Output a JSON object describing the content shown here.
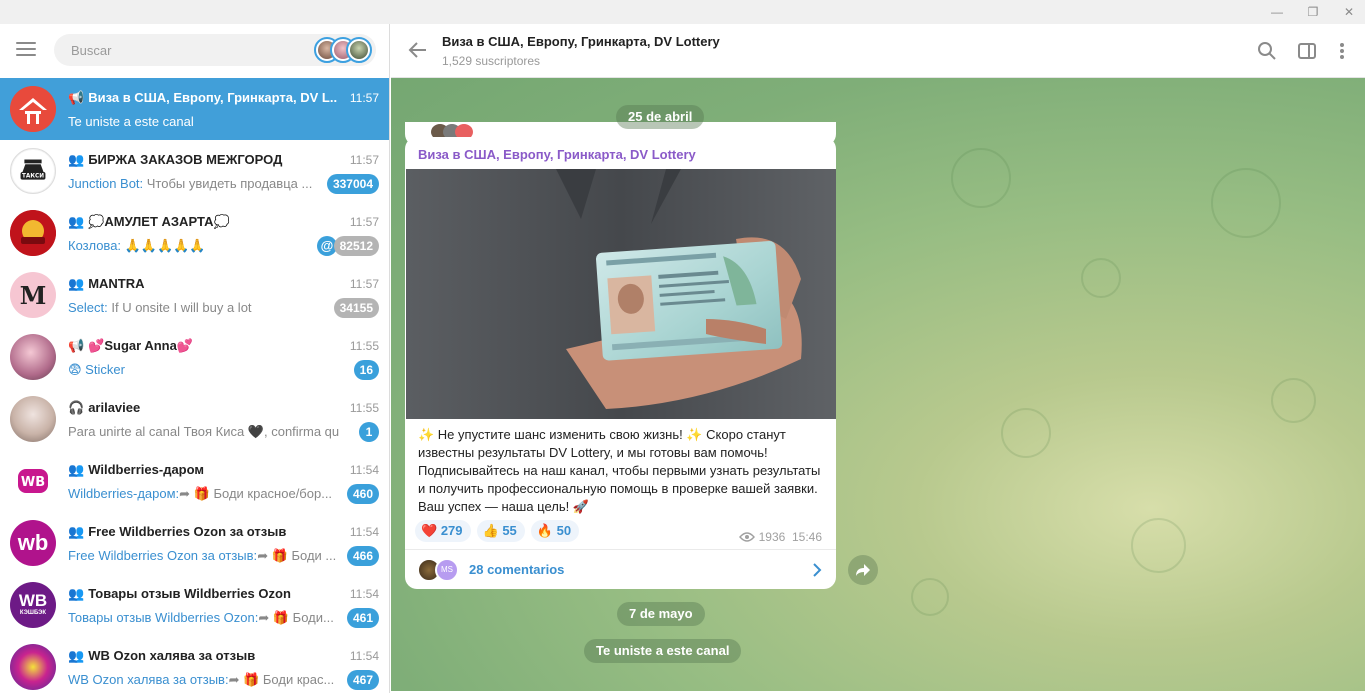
{
  "window": {
    "minimize": "—",
    "restore": "❐",
    "close": "✕"
  },
  "search": {
    "placeholder": "Buscar"
  },
  "chats": [
    {
      "title": "Виза в США, Европу, Гринкарта, DV L...",
      "type_icon": "📢",
      "time": "11:57",
      "sender": "",
      "preview": "Te uniste a este canal",
      "badge": "",
      "active": true
    },
    {
      "title": "БИРЖА ЗАКАЗОВ МЕЖГОРОД",
      "type_icon": "👥",
      "time": "11:57",
      "sender": "Junction Bot:",
      "preview": " Чтобы увидеть продавца ...",
      "badge": "337004"
    },
    {
      "title": "💭АМУЛЕТ АЗАРТА💭",
      "type_icon": "👥",
      "time": "11:57",
      "sender": "Козлова:",
      "preview": " 🙏🙏🙏🙏🙏",
      "badge": "82512",
      "mention": "@"
    },
    {
      "title": "MANTRA",
      "type_icon": "👥",
      "time": "11:57",
      "sender": "Select:",
      "preview": " If U onsite I will buy a lot",
      "badge": "34155"
    },
    {
      "title": "💕Sugar Anna💕",
      "type_icon": "📢",
      "time": "11:55",
      "sender": "😨 Sticker",
      "preview": "",
      "badge": "16"
    },
    {
      "title": "arilaviee",
      "type_icon": "🎧",
      "time": "11:55",
      "sender": "",
      "preview": "Para unirte al canal Твоя Киса 🖤, confirma qu...",
      "badge": "1"
    },
    {
      "title": "Wildberries-даром",
      "type_icon": "👥",
      "time": "11:54",
      "sender": "Wildberries-даром:",
      "preview": "➦ 🎁 Боди красное/бор...",
      "badge": "460"
    },
    {
      "title": "Free Wildberries Ozon за отзыв",
      "type_icon": "👥",
      "time": "11:54",
      "sender": "Free Wildberries Ozon за отзыв:",
      "preview": "➦ 🎁 Боди ...",
      "badge": "466"
    },
    {
      "title": "Товары отзыв Wildberries Ozon",
      "type_icon": "👥",
      "time": "11:54",
      "sender": "Товары отзыв Wildberries Ozon:",
      "preview": "➦ 🎁 Боди...",
      "badge": "461"
    },
    {
      "title": "WB Ozon халява за отзыв",
      "type_icon": "👥",
      "time": "11:54",
      "sender": "WB Ozon халява за отзыв:",
      "preview": "➦ 🎁 Боди крас...",
      "badge": "467"
    }
  ],
  "avatars": {
    "taxi": "ТАКСИ",
    "mantra": "M",
    "wb1": "WB",
    "wb2": "wb",
    "wb3": "WB",
    "wb3_sub": "КЭШБЭК"
  },
  "channel": {
    "title": "Виза в США, Европу, Гринкарта, DV Lottery",
    "subtitle": "1,529 suscriptores"
  },
  "messages": {
    "date1": "25 de abril",
    "post_author": "Виза в США, Европу, Гринкарта, DV Lottery",
    "post_text": "✨ Не упустите шанс изменить свою жизнь! ✨ Скоро станут известны результаты DV Lottery, и мы готовы вам помочь! Подписывайтесь на наш канал, чтобы первыми узнать результаты и получить профессиональную помощь в проверке вашей заявки. Ваш успех — наша цель! 🚀",
    "reactions": [
      {
        "emoji": "❤️",
        "count": "279"
      },
      {
        "emoji": "👍",
        "count": "55"
      },
      {
        "emoji": "🔥",
        "count": "50"
      }
    ],
    "views": "1936",
    "time": "15:46",
    "comment_avatar_initials": "MS",
    "comments": "28 comentarios",
    "date2": "7 de mayo",
    "service": "Te uniste a este canal"
  },
  "colors": {
    "accent": "#419fd9",
    "author": "#8a5ac8",
    "badge": "#3aa0db",
    "badge_muted": "#b4b4b4"
  }
}
